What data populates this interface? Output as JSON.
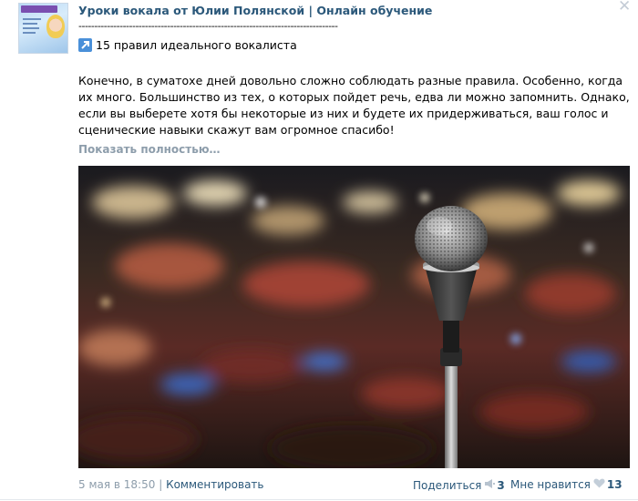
{
  "post": {
    "group_title": "Уроки вокала от Юлии Полянской | Онлайн обучение",
    "divider": "----------------------------------------------------------------------------------",
    "link_text": "15 правил идеального вокалиста",
    "body": "Конечно, в суматохе дней довольно сложно соблюдать разные правила. Особенно, когда их много. Большинство из тех, о которых пойдет речь, едва ли можно запомнить. Однако, если вы выберете хотя бы некоторые из них и будете их придерживаться, ваш голос и сценические навыки скажут вам огромное спасибо!",
    "show_more": "Показать полностью…",
    "close_symbol": "✕"
  },
  "footer": {
    "date": "5 мая в 18:50",
    "separator": "|",
    "comment": "Комментировать",
    "share": "Поделиться",
    "share_count": "3",
    "like": "Мне нравится",
    "like_count": "13"
  },
  "colors": {
    "link": "#2b587a",
    "muted": "#8d9dab",
    "icon_bg": "#4a90d9"
  },
  "icons": {
    "arrow": "arrow-up-right-icon",
    "share": "megaphone-icon",
    "like": "heart-icon",
    "close": "close-icon"
  }
}
